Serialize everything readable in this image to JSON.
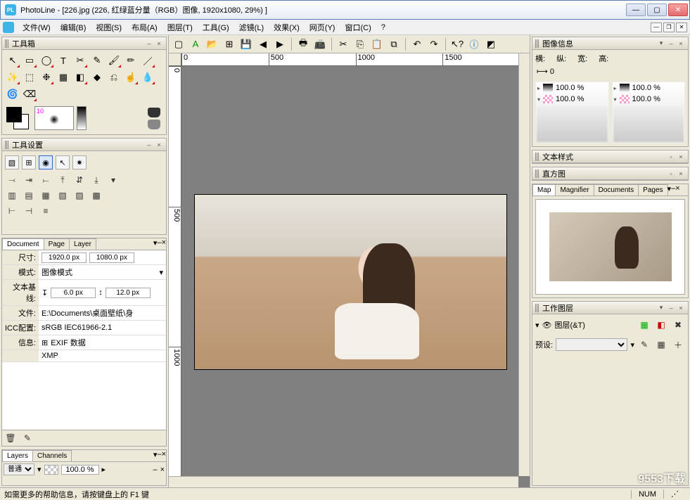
{
  "titlebar": {
    "app": "PhotoLine",
    "doc": "[226.jpg  (226, 红绿蓝分量（RGB）图像, 1920x1080, 29%) ]"
  },
  "menu": [
    "文件(W)",
    "编辑(B)",
    "视图(S)",
    "布局(A)",
    "图层(T)",
    "工具(G)",
    "滤镜(L)",
    "效果(X)",
    "网页(Y)",
    "窗口(C)",
    "?"
  ],
  "panels": {
    "toolbox": "工具箱",
    "toolsettings": "工具设置",
    "imageinfo": "图像信息",
    "textstyle": "文本样式",
    "histogram": "直方图",
    "workinglayer": "工作图层"
  },
  "brush_size": "10",
  "doc_tabs": [
    "Document",
    "Page",
    "Layer"
  ],
  "doc": {
    "size_lbl": "尺寸:",
    "w": "1920.0 px",
    "h": "1080.0 px",
    "mode_lbl": "模式:",
    "mode": "图像模式",
    "baseline_lbl": "文本基线:",
    "bl1": "6.0 px",
    "bl2": "12.0 px",
    "file_lbl": "文件:",
    "file": "E:\\Documents\\桌面壁纸\\身",
    "icc_lbl": "ICC配置:",
    "icc": "sRGB IEC61966-2.1",
    "info_lbl": "信息:",
    "info1": "EXIF 数据",
    "info2": "XMP"
  },
  "layer_tabs": [
    "Layers",
    "Channels"
  ],
  "layer_mode": "普通",
  "layer_opacity": "100.0 %",
  "ruler_h": [
    "0",
    "500",
    "1000",
    "1500"
  ],
  "ruler_v": [
    "0",
    "500",
    "1000"
  ],
  "imageinfo": {
    "w_lbl": "横:",
    "h_lbl": "纵:",
    "x_lbl": "宽:",
    "y_lbl": "高:",
    "arrow": "⟼ 0"
  },
  "thumb_vals": [
    "100.0 %",
    "100.0 %",
    "100.0 %",
    "100.0 %"
  ],
  "nav_tabs": [
    "Map",
    "Magnifier",
    "Documents",
    "Pages"
  ],
  "workinglayer": {
    "layer_lbl": "图层(&T)",
    "preset_lbl": "预设:"
  },
  "status": {
    "help": "如需更多的帮助信息，请按键盘上的 F1 键",
    "num": "NUM"
  },
  "watermark": "9553下载"
}
